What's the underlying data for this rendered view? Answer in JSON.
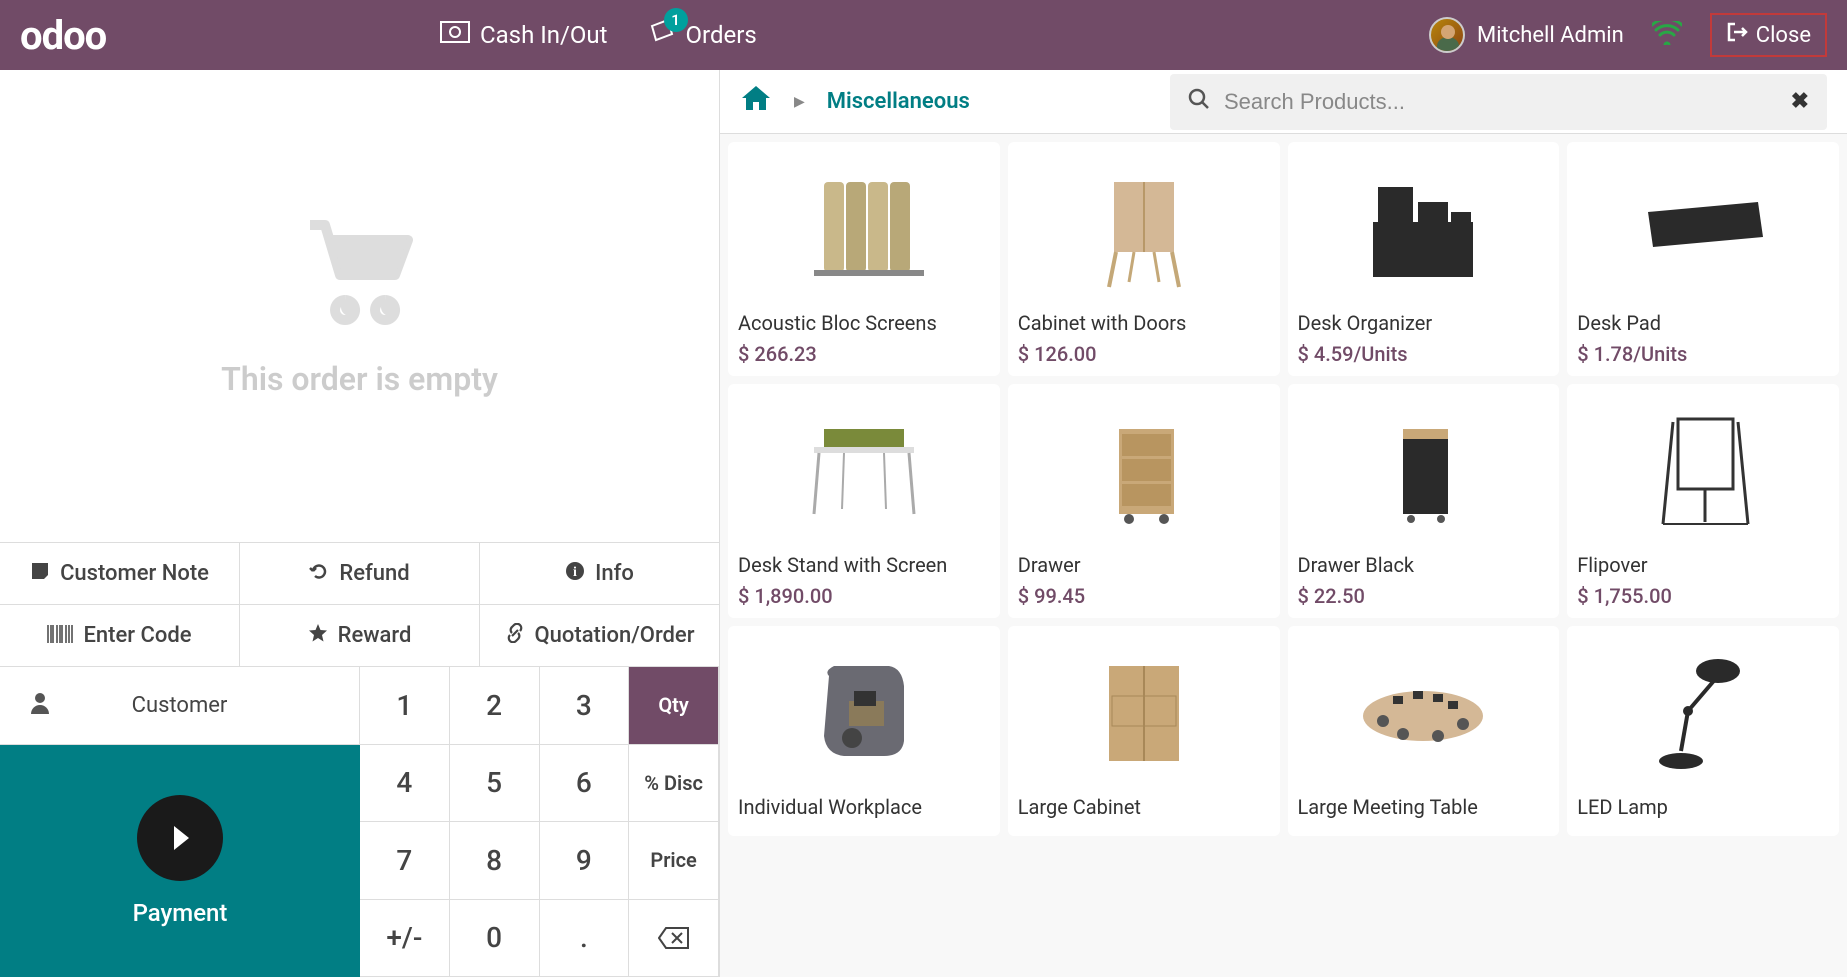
{
  "brand": "odoo",
  "topbar": {
    "cash_label": "Cash In/Out",
    "orders_label": "Orders",
    "orders_badge": "1",
    "username": "Mitchell Admin",
    "close_label": "Close"
  },
  "order": {
    "empty_text": "This order is empty"
  },
  "actions": {
    "customer_note": "Customer Note",
    "refund": "Refund",
    "info": "Info",
    "enter_code": "Enter Code",
    "reward": "Reward",
    "quotation": "Quotation/Order"
  },
  "customer_label": "Customer",
  "payment_label": "Payment",
  "numpad": {
    "k1": "1",
    "k2": "2",
    "k3": "3",
    "qty": "Qty",
    "k4": "4",
    "k5": "5",
    "k6": "6",
    "disc": "% Disc",
    "k7": "7",
    "k8": "8",
    "k9": "9",
    "price": "Price",
    "sign": "+/-",
    "k0": "0",
    "dot": ".",
    "bksp": "⌫"
  },
  "breadcrumb": {
    "category": "Miscellaneous"
  },
  "search": {
    "placeholder": "Search Products..."
  },
  "products": [
    {
      "name": "Acoustic Bloc Screens",
      "price": "$ 266.23"
    },
    {
      "name": "Cabinet with Doors",
      "price": "$ 126.00"
    },
    {
      "name": "Desk Organizer",
      "price": "$ 4.59/Units"
    },
    {
      "name": "Desk Pad",
      "price": "$ 1.78/Units"
    },
    {
      "name": "Desk Stand with Screen",
      "price": "$ 1,890.00"
    },
    {
      "name": "Drawer",
      "price": "$ 99.45"
    },
    {
      "name": "Drawer Black",
      "price": "$ 22.50"
    },
    {
      "name": "Flipover",
      "price": "$ 1,755.00"
    },
    {
      "name": "Individual Workplace",
      "price": ""
    },
    {
      "name": "Large Cabinet",
      "price": ""
    },
    {
      "name": "Large Meeting Table",
      "price": ""
    },
    {
      "name": "LED Lamp",
      "price": ""
    }
  ]
}
